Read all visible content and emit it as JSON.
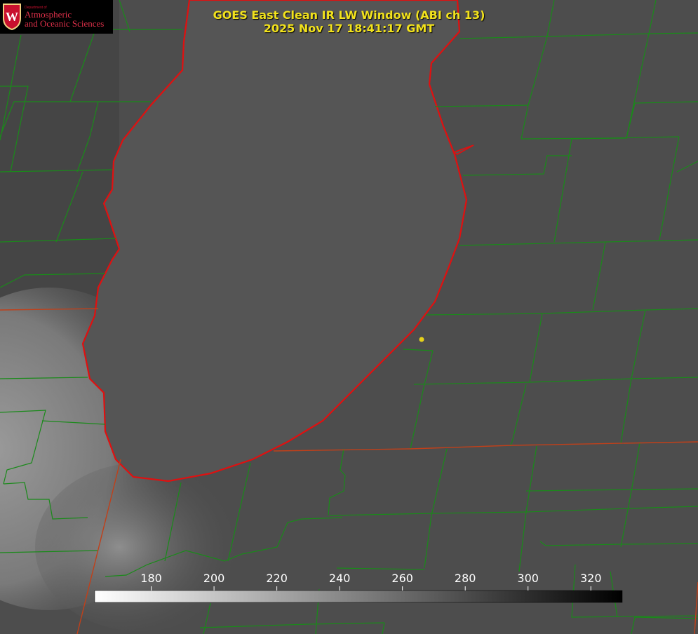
{
  "title": {
    "line1": "GOES East Clean IR LW Window (ABI ch 13)",
    "line2": "2025 Nov 17 18:41:17 GMT"
  },
  "logo": {
    "department": "Department of",
    "line1": "Atmospheric",
    "line2": "and Oceanic Sciences",
    "crest_letter": "W",
    "icon": "uw-crest-icon",
    "color": "#c8102e"
  },
  "colorbar": {
    "ticks": [
      {
        "value": 180,
        "label": "180"
      },
      {
        "value": 200,
        "label": "200"
      },
      {
        "value": 220,
        "label": "220"
      },
      {
        "value": 240,
        "label": "240"
      },
      {
        "value": 260,
        "label": "260"
      },
      {
        "value": 280,
        "label": "280"
      },
      {
        "value": 300,
        "label": "300"
      },
      {
        "value": 320,
        "label": "320"
      }
    ],
    "min": 162,
    "max": 330,
    "color_low": "#ffffff",
    "color_high": "#000000"
  },
  "colors": {
    "county_lines": "#1a8a1a",
    "state_lines": "#c0401a",
    "lake_outline": "#e01010",
    "title_text": "#f2e21c",
    "station_dot": "#e6d21a"
  }
}
